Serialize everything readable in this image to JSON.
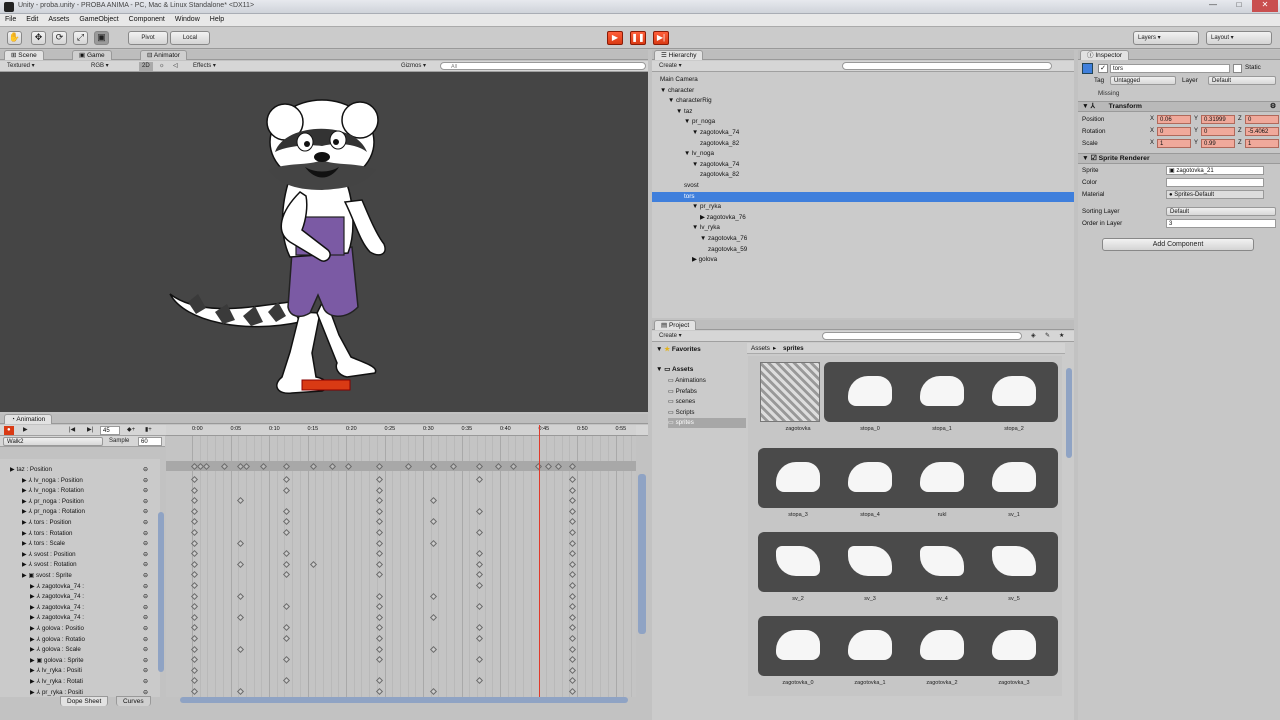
{
  "window": {
    "title": "Unity - proba.unity - PROBA ANIMA - PC, Mac & Linux Standalone* <DX11>"
  },
  "menu": [
    "File",
    "Edit",
    "Assets",
    "GameObject",
    "Component",
    "Window",
    "Help"
  ],
  "toolbar": {
    "pivot": "Pivot",
    "local": "Local",
    "layers": "Layers",
    "layout": "Layout"
  },
  "scene": {
    "tabs": [
      "Scene",
      "Game",
      "Animator"
    ],
    "shading": "Textured",
    "rgb": "RGB",
    "mode2d": "2D",
    "effects": "Effects",
    "gizmos": "Gizmos",
    "search_placeholder": "All"
  },
  "animation": {
    "tab": "Animation",
    "clip": "Walk2",
    "sample_label": "Sample",
    "sample": "60",
    "frame": "45",
    "times": [
      "0:00",
      "0:05",
      "0:10",
      "0:15",
      "0:20",
      "0:25",
      "0:30",
      "0:35",
      "0:40",
      "0:45",
      "0:50",
      "0:55"
    ],
    "tracks": [
      {
        "label": "▶ taz : Position",
        "k": [
          1,
          0,
          1,
          0,
          0,
          1,
          0,
          1,
          0,
          1
        ]
      },
      {
        "label": "▶ ⅄ lv_noga : Position",
        "k": [
          1,
          0,
          1,
          0,
          0,
          1,
          0,
          0,
          0,
          1
        ]
      },
      {
        "label": "▶ ⅄ lv_noga : Rotation",
        "k": [
          1,
          1,
          0,
          0,
          0,
          1,
          1,
          0,
          0,
          1
        ]
      },
      {
        "label": "▶ ⅄ pr_noga : Position",
        "k": [
          1,
          0,
          1,
          0,
          0,
          1,
          0,
          1,
          0,
          1
        ]
      },
      {
        "label": "▶ ⅄ pr_noga : Rotation",
        "k": [
          1,
          0,
          1,
          0,
          0,
          1,
          1,
          0,
          0,
          1
        ]
      },
      {
        "label": "▶ ⅄ tors : Position",
        "k": [
          1,
          0,
          1,
          0,
          0,
          1,
          0,
          1,
          0,
          1
        ]
      },
      {
        "label": "▶ ⅄ tors : Rotation",
        "k": [
          1,
          1,
          0,
          0,
          0,
          1,
          1,
          0,
          0,
          1
        ]
      },
      {
        "label": "▶ ⅄ tors : Scale",
        "k": [
          1,
          0,
          1,
          0,
          0,
          1,
          0,
          1,
          0,
          1
        ]
      },
      {
        "label": "▶ ⅄ svost : Position",
        "k": [
          1,
          1,
          1,
          1,
          0,
          1,
          0,
          1,
          0,
          1
        ]
      },
      {
        "label": "▶ ⅄ svost : Rotation",
        "k": [
          1,
          0,
          1,
          0,
          0,
          1,
          0,
          1,
          0,
          1
        ]
      },
      {
        "label": "▶ ▣ svost : Sprite",
        "k": [
          1,
          0,
          0,
          0,
          0,
          0,
          0,
          1,
          0,
          1
        ]
      },
      {
        "label": "▶ ⅄ zagotovka_74 :",
        "k": [
          1,
          1,
          0,
          0,
          0,
          1,
          1,
          0,
          0,
          1
        ]
      },
      {
        "label": "▶ ⅄ zagotovka_74 :",
        "k": [
          1,
          0,
          1,
          0,
          0,
          1,
          0,
          1,
          0,
          1
        ]
      },
      {
        "label": "▶ ⅄ zagotovka_74 :",
        "k": [
          1,
          1,
          0,
          0,
          0,
          1,
          1,
          0,
          0,
          1
        ]
      },
      {
        "label": "▶ ⅄ zagotovka_74 :",
        "k": [
          1,
          0,
          1,
          0,
          0,
          1,
          0,
          1,
          0,
          1
        ]
      },
      {
        "label": "▶ ⅄ golova : Positio",
        "k": [
          1,
          0,
          1,
          0,
          0,
          1,
          0,
          1,
          0,
          1
        ]
      },
      {
        "label": "▶ ⅄ golova : Rotatio",
        "k": [
          1,
          1,
          0,
          0,
          0,
          1,
          1,
          0,
          0,
          1
        ]
      },
      {
        "label": "▶ ⅄ golova : Scale",
        "k": [
          1,
          0,
          1,
          0,
          0,
          1,
          0,
          1,
          0,
          1
        ]
      },
      {
        "label": "▶ ▣ golova : Sprite",
        "k": [
          1,
          0,
          0,
          0,
          0,
          0,
          0,
          0,
          0,
          1
        ]
      },
      {
        "label": "▶ ⅄ lv_ryka : Positi",
        "k": [
          1,
          0,
          1,
          0,
          0,
          1,
          0,
          1,
          0,
          1
        ]
      },
      {
        "label": "▶ ⅄ lv_ryka : Rotati",
        "k": [
          1,
          1,
          0,
          0,
          0,
          1,
          1,
          0,
          0,
          1
        ]
      },
      {
        "label": "▶ ⅄ pr_ryka : Positi",
        "k": [
          1,
          0,
          1,
          0,
          0,
          1,
          0,
          1,
          0,
          1
        ]
      }
    ],
    "bottom_tabs": [
      "Dope Sheet",
      "Curves"
    ]
  },
  "hierarchy": {
    "tab": "Hierarchy",
    "create": "Create",
    "items": [
      {
        "label": "Main Camera",
        "indent": 0
      },
      {
        "label": "▼ character",
        "indent": 0
      },
      {
        "label": "▼ characterRig",
        "indent": 1
      },
      {
        "label": "▼ taz",
        "indent": 2
      },
      {
        "label": "▼ pr_noga",
        "indent": 3
      },
      {
        "label": "▼ zagotovka_74",
        "indent": 4
      },
      {
        "label": "zagotovka_82",
        "indent": 5
      },
      {
        "label": "▼ lv_noga",
        "indent": 3
      },
      {
        "label": "▼ zagotovka_74",
        "indent": 4
      },
      {
        "label": "zagotovka_82",
        "indent": 5
      },
      {
        "label": "svost",
        "indent": 3
      },
      {
        "label": "tors",
        "indent": 3,
        "sel": true
      },
      {
        "label": "▼ pr_ryka",
        "indent": 4
      },
      {
        "label": "▶ zagotovka_76",
        "indent": 5
      },
      {
        "label": "▼ lv_ryka",
        "indent": 4
      },
      {
        "label": "▼ zagotovka_76",
        "indent": 5
      },
      {
        "label": "zagotovka_59",
        "indent": 6
      },
      {
        "label": "▶ golova",
        "indent": 4
      }
    ]
  },
  "project": {
    "tab": "Project",
    "create": "Create",
    "favorites": "Favorites",
    "assets": "Assets",
    "folders": [
      "Animations",
      "Prefabs",
      "scenes",
      "Scripts",
      "sprites"
    ],
    "breadcrumb_root": "Assets",
    "breadcrumb_leaf": "sprites",
    "sprites": [
      "zagotovka",
      "stopa_0",
      "stopa_1",
      "stopa_2",
      "stopa_3",
      "stopa_4",
      "rukl",
      "sv_1",
      "sv_2",
      "sv_3",
      "sv_4",
      "sv_5",
      "zagotovka_0",
      "zagotovka_1",
      "zagotovka_2",
      "zagotovka_3"
    ]
  },
  "inspector": {
    "tab": "Inspector",
    "name": "tors",
    "static": "Static",
    "tag_label": "Tag",
    "tag": "Untagged",
    "layer_label": "Layer",
    "layer": "Default",
    "missing": "Missing",
    "transform": "Transform",
    "position_label": "Position",
    "rotation_label": "Rotation",
    "scale_label": "Scale",
    "pos": [
      "0.06",
      "0.31999",
      "0"
    ],
    "rot": [
      "0",
      "0",
      "-5.4062"
    ],
    "scl": [
      "1",
      "0.99",
      "1"
    ],
    "sr": "Sprite Renderer",
    "sprite_label": "Sprite",
    "sprite": "zagotovka_21",
    "color_label": "Color",
    "material_label": "Material",
    "material": "Sprites-Default",
    "sorting_label": "Sorting Layer",
    "sorting": "Default",
    "order_label": "Order in Layer",
    "order": "3",
    "add_component": "Add Component"
  },
  "colors": {
    "accent": "#3f7fdc",
    "play": "#ff5e3a",
    "scene_bg": "#454545",
    "playhead": "#e03a2a"
  }
}
